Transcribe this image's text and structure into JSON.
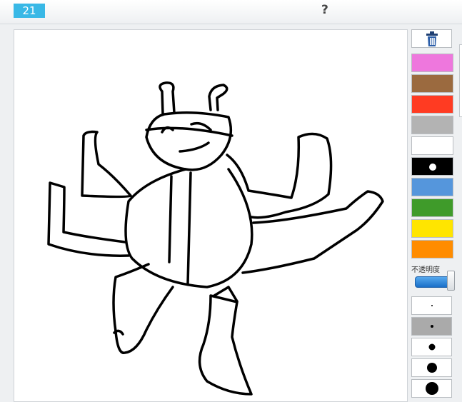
{
  "header": {
    "counter": "21",
    "help": "?"
  },
  "toolbar": {
    "clear_icon": "trash-icon",
    "colors": [
      {
        "name": "pink",
        "hex": "#ee77dd"
      },
      {
        "name": "brown",
        "hex": "#9b6a3f"
      },
      {
        "name": "red",
        "hex": "#ff3b22"
      },
      {
        "name": "gray",
        "hex": "#b3b3b3"
      },
      {
        "name": "white",
        "hex": "#ffffff"
      },
      {
        "name": "black",
        "hex": "#000000",
        "selected": true
      },
      {
        "name": "blue",
        "hex": "#5596dc"
      },
      {
        "name": "green",
        "hex": "#3f9b2a"
      },
      {
        "name": "yellow",
        "hex": "#ffe500"
      },
      {
        "name": "orange",
        "hex": "#ff8c00"
      }
    ],
    "opacity_label": "不透明度",
    "opacity_value": 1.0,
    "brush_sizes": [
      {
        "label": "size-1",
        "selected": false
      },
      {
        "label": "size-2",
        "selected": true
      },
      {
        "label": "size-3",
        "selected": false
      },
      {
        "label": "size-4",
        "selected": false
      },
      {
        "label": "size-5",
        "selected": false
      }
    ]
  },
  "canvas": {
    "stroke_color": "#000000",
    "drawing": "stick-figure-sketch"
  }
}
